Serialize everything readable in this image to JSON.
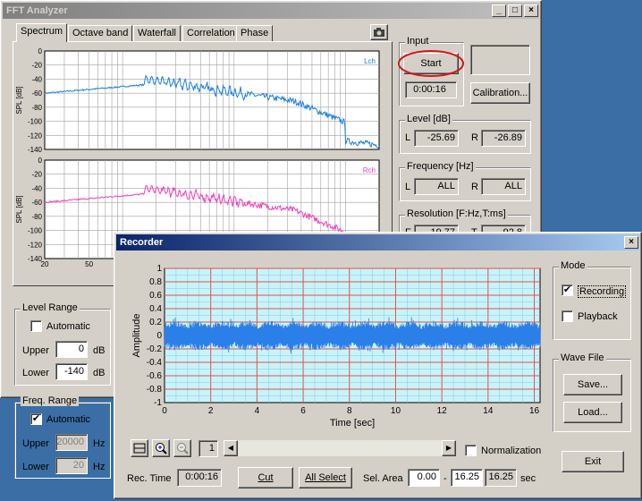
{
  "fft": {
    "title": "FFT Analyzer",
    "tabs": [
      "Spectrum",
      "Octave band",
      "Waterfall",
      "Correlation",
      "Phase"
    ],
    "input_label": "Input",
    "start_button": "Start",
    "elapsed": "0:00:16",
    "calibration_button": "Calibration...",
    "level_label": "Level [dB]",
    "level_l": "-25.69",
    "level_r": "-26.89",
    "l": "L",
    "r": "R",
    "freq_label": "Frequency [Hz]",
    "freq_l": "ALL",
    "freq_r": "ALL",
    "res_label": "Resolution [F:Hz,T:ms]",
    "res_f_partial": "19.77",
    "res_t_partial": "92.8",
    "res_f_letter": "F",
    "res_t_letter": "T",
    "level_range": {
      "label": "Level Range",
      "automatic": "Automatic",
      "automatic_checked": false,
      "upper_label": "Upper",
      "upper": "0",
      "lower_label": "Lower",
      "lower": "-140",
      "unit": "dB"
    },
    "freq_range": {
      "label": "Freq. Range",
      "automatic": "Automatic",
      "automatic_checked": true,
      "upper_label": "Upper",
      "upper": "20000",
      "lower_label": "Lower",
      "lower": "20",
      "unit": "Hz"
    },
    "spectrum_top": {
      "ylabel": "SPL [dB]",
      "channel": "Lch",
      "color": "#1a7fe0",
      "yticks": [
        "0",
        "-20",
        "-40",
        "-60",
        "-80",
        "-100",
        "-120",
        "-140"
      ]
    },
    "spectrum_bottom": {
      "ylabel": "SPL [dB]",
      "channel": "Rch",
      "color": "#f040c0",
      "yticks": [
        "0",
        "-20",
        "-40",
        "-60",
        "-80",
        "-100",
        "-120",
        "-140"
      ],
      "xticks": [
        "20",
        "50"
      ]
    }
  },
  "recorder": {
    "title": "Recorder",
    "mode_label": "Mode",
    "recording": "Recording",
    "recording_checked": true,
    "playback": "Playback",
    "playback_checked": false,
    "wave_file_label": "Wave File",
    "save_button": "Save...",
    "load_button": "Load...",
    "exit_button": "Exit",
    "page": "1",
    "normalization": "Normalization",
    "rec_time_label": "Rec. Time",
    "rec_time": "0:00:16",
    "cut_button": "Cut",
    "all_select_button": "All Select",
    "sel_area_label": "Sel. Area",
    "sel_start": "0.00",
    "sel_dash": "-",
    "sel_end": "16.25",
    "sel_length": "16.25",
    "sel_unit": "sec",
    "chart_data": {
      "type": "line",
      "ylabel": "Amplitude",
      "xlabel": "Time [sec]",
      "xlim": [
        0,
        16.25
      ],
      "ylim": [
        -1,
        1
      ],
      "xticks": [
        "0",
        "2",
        "4",
        "6",
        "8",
        "10",
        "12",
        "14",
        "16"
      ],
      "yticks": [
        "1",
        "0.8",
        "0.6",
        "0.4",
        "0.2",
        "0",
        "-0.2",
        "-0.4",
        "-0.6",
        "-0.8",
        "-1"
      ],
      "envelope_amplitude": 0.22,
      "color": "#2a7fe8",
      "grid": true
    }
  }
}
